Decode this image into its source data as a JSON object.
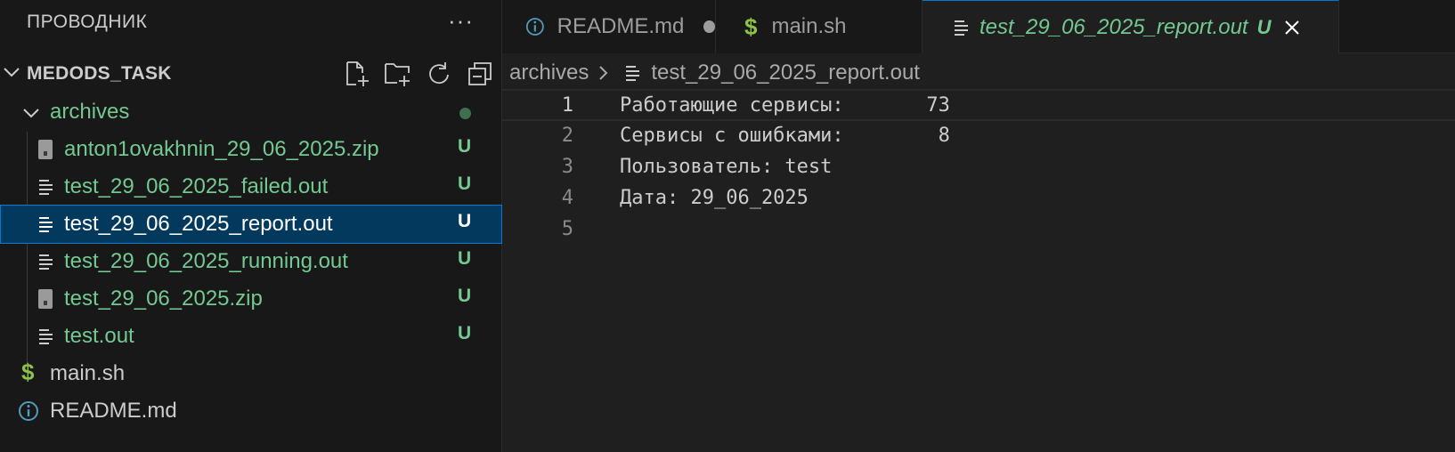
{
  "explorer": {
    "title": "ПРОВОДНИК",
    "more_label": "···",
    "project": {
      "name": "MEDODS_TASK",
      "actions": [
        "new-file-icon",
        "new-folder-icon",
        "refresh-icon",
        "collapse-all-icon"
      ]
    },
    "items": [
      {
        "label": "archives",
        "type": "folder",
        "badge": ""
      },
      {
        "label": "anton1ovakhnin_29_06_2025.zip",
        "type": "zip",
        "badge": "U"
      },
      {
        "label": "test_29_06_2025_failed.out",
        "type": "text",
        "badge": "U"
      },
      {
        "label": "test_29_06_2025_report.out",
        "type": "text",
        "badge": "U",
        "selected": true
      },
      {
        "label": "test_29_06_2025_running.out",
        "type": "text",
        "badge": "U"
      },
      {
        "label": "test_29_06_2025.zip",
        "type": "zip",
        "badge": "U"
      },
      {
        "label": "test.out",
        "type": "text",
        "badge": "U"
      },
      {
        "label": "main.sh",
        "type": "shell",
        "badge": ""
      },
      {
        "label": "README.md",
        "type": "info",
        "badge": ""
      }
    ]
  },
  "tabs": [
    {
      "label": "README.md",
      "icon": "info-icon",
      "modified": true
    },
    {
      "label": "main.sh",
      "icon": "dollar-icon"
    },
    {
      "label": "test_29_06_2025_report.out",
      "icon": "lines-icon",
      "badge": "U",
      "active": true
    }
  ],
  "breadcrumb": {
    "folder": "archives",
    "file": "test_29_06_2025_report.out"
  },
  "editor": {
    "lines": [
      {
        "num": "1",
        "text": "Работающие сервисы:       73"
      },
      {
        "num": "2",
        "text": "Сервисы с ошибками:        8"
      },
      {
        "num": "3",
        "text": "Пользователь: test"
      },
      {
        "num": "4",
        "text": "Дата: 29_06_2025"
      },
      {
        "num": "5",
        "text": ""
      }
    ]
  },
  "colors": {
    "accent": "#0078d4",
    "untracked_green": "#73c991",
    "selection_bg": "#04395e",
    "shell_icon": "#8dc149",
    "info_icon": "#519aba"
  }
}
